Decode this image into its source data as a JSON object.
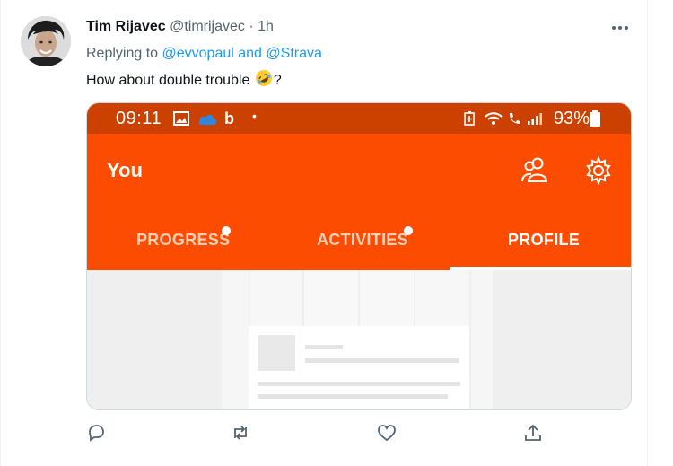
{
  "tweet": {
    "author_name": "Tim Rijavec",
    "author_handle": "@timrijavec",
    "separator": "·",
    "time": "1h",
    "replying_prefix": "Replying to",
    "replying_user1": "@evvopaul",
    "replying_and": "and",
    "replying_user2": "@Strava",
    "text_before": "How about double trouble",
    "text_after": "?",
    "emoji": "rolling-on-floor-laughing-emoji"
  },
  "screenshot": {
    "status_time": "09:11",
    "battery": "93%",
    "title": "You",
    "tabs": [
      {
        "label": "PROGRESS",
        "active": false,
        "has_dot": true
      },
      {
        "label": "ACTIVITIES",
        "active": false,
        "has_dot": true
      },
      {
        "label": "PROFILE",
        "active": true,
        "has_dot": false
      }
    ],
    "colors": {
      "strava_orange": "#fc4c02",
      "status_bar": "#cc4100"
    }
  },
  "actions": {
    "icons": [
      "reply-icon",
      "retweet-icon",
      "like-icon",
      "share-icon"
    ]
  },
  "colors": {
    "link": "#1d9bf0",
    "secondary_text": "#536471"
  }
}
